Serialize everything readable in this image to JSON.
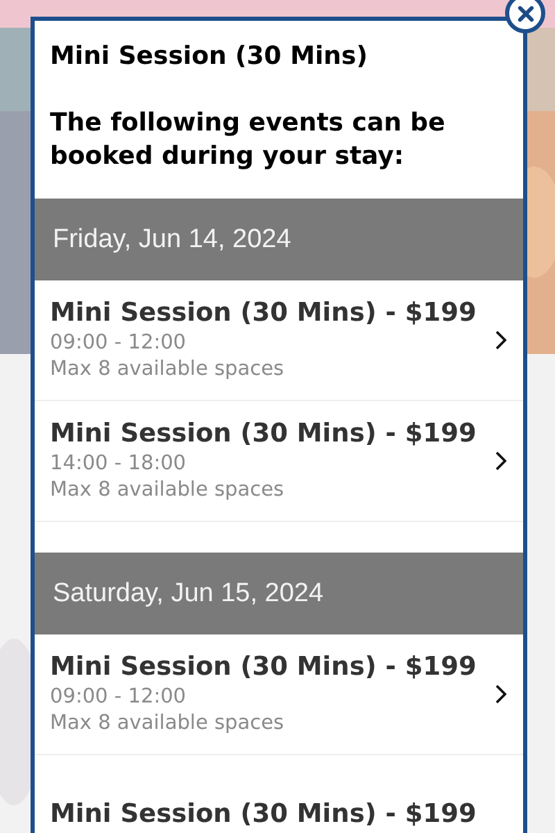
{
  "modal": {
    "title": "Mini Session (30 Mins)",
    "intro": "The following events can be booked during your stay:",
    "days": [
      {
        "date": "Friday, Jun 14, 2024",
        "events": [
          {
            "title": "Mini Session (30 Mins) - $199",
            "time": "09:00 - 12:00",
            "spaces": "Max 8 available spaces"
          },
          {
            "title": "Mini Session (30 Mins) - $199",
            "time": "14:00 - 18:00",
            "spaces": "Max 8 available spaces"
          }
        ]
      },
      {
        "date": "Saturday, Jun 15, 2024",
        "events": [
          {
            "title": "Mini Session (30 Mins) - $199",
            "time": "09:00 - 12:00",
            "spaces": "Max 8 available spaces"
          },
          {
            "title": "Mini Session (30 Mins) - $199"
          }
        ]
      }
    ]
  }
}
